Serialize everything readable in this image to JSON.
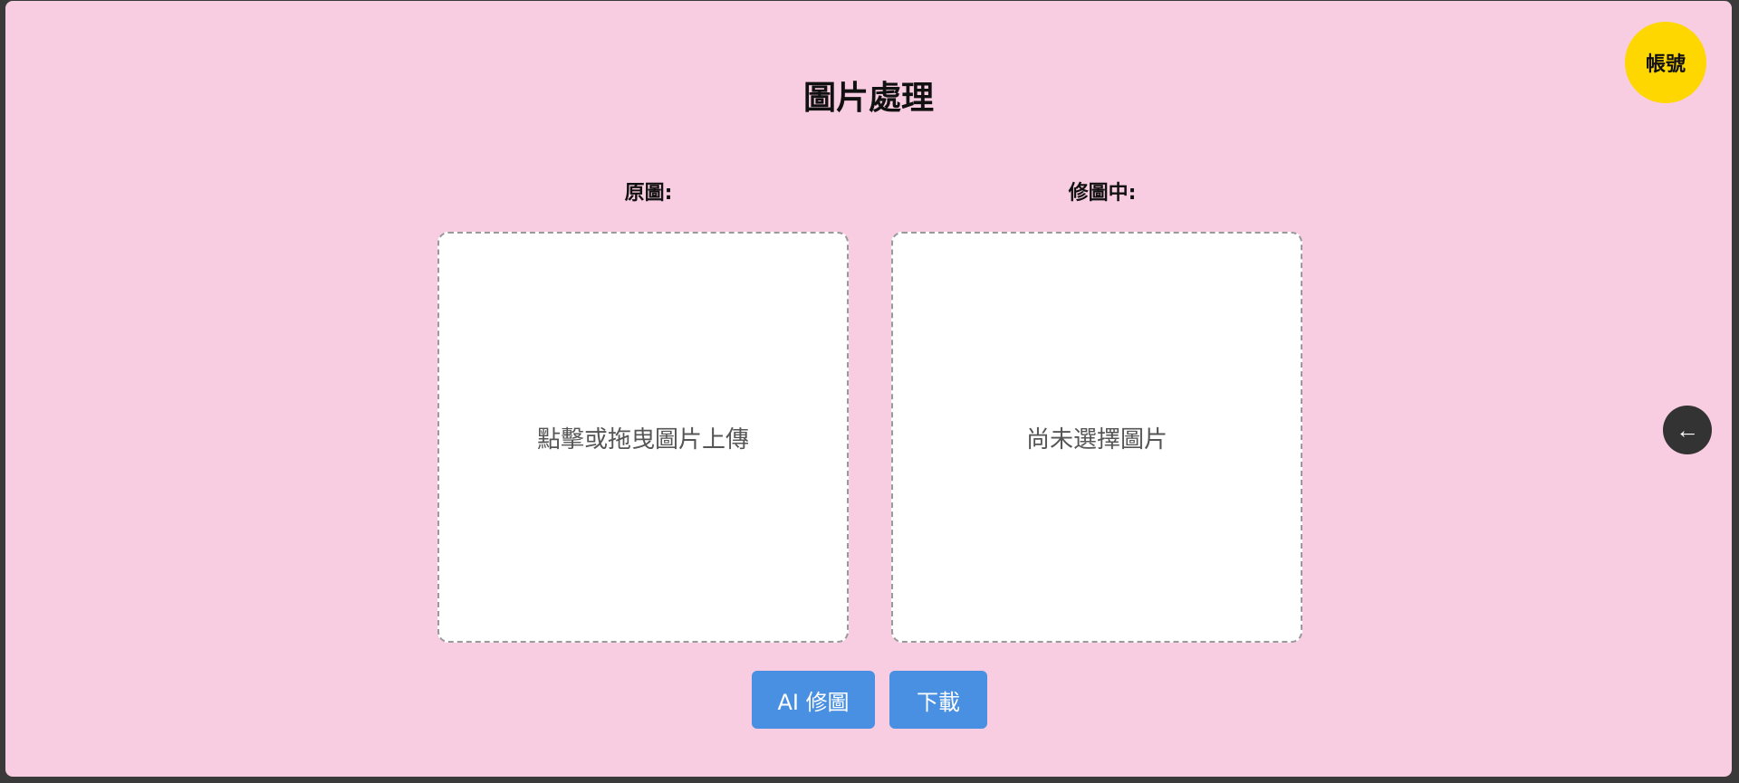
{
  "header": {
    "title": "圖片處理",
    "account_label": "帳號"
  },
  "panels": {
    "original": {
      "label": "原圖:",
      "placeholder": "點擊或拖曳圖片上傳"
    },
    "editing": {
      "label": "修圖中:",
      "placeholder": "尚未選擇圖片"
    }
  },
  "actions": {
    "ai_edit_label": "AI 修圖",
    "download_label": "下載"
  },
  "back": {
    "icon": "left-arrow-icon",
    "glyph": "←"
  },
  "colors": {
    "background": "#f8cce1",
    "account": "#ffd700",
    "button": "#4a90e2",
    "back_button": "#333333"
  }
}
